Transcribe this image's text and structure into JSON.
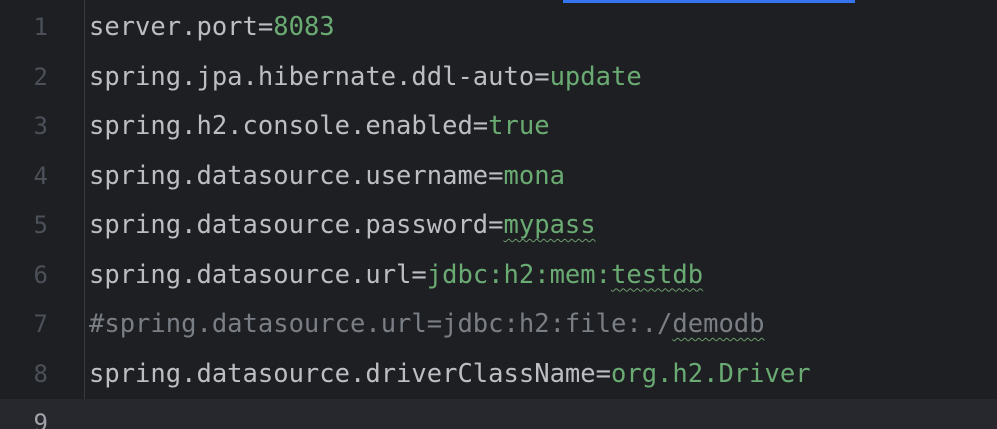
{
  "editor": {
    "lines": [
      {
        "number": "1",
        "key": "server.port=",
        "value": "8083"
      },
      {
        "number": "2",
        "key": "spring.jpa.hibernate.ddl-auto=",
        "value": "update"
      },
      {
        "number": "3",
        "key": "spring.h2.console.enabled=",
        "value": "true"
      },
      {
        "number": "4",
        "key": "spring.datasource.username=",
        "value": "mona"
      },
      {
        "number": "5",
        "key": "spring.datasource.password=",
        "value": "mypass"
      },
      {
        "number": "6",
        "key": "spring.datasource.url=",
        "value_prefix": "jdbc:h2:mem:",
        "value_typo": "testdb"
      },
      {
        "number": "7",
        "comment_prefix": "#spring.datasource.url=jdbc:h2:file:./",
        "comment_typo": "demodb"
      },
      {
        "number": "8",
        "key": "spring.datasource.driverClassName=",
        "value": "org.h2.Driver"
      },
      {
        "number": "9",
        "key": ""
      }
    ]
  },
  "colors": {
    "background": "#1e1f22",
    "current_line": "#26282e",
    "key_text": "#bcbec4",
    "value_text": "#6aab73",
    "comment_text": "#7a7e85",
    "line_number": "#4b5059",
    "tab_accent": "#3574f0"
  }
}
